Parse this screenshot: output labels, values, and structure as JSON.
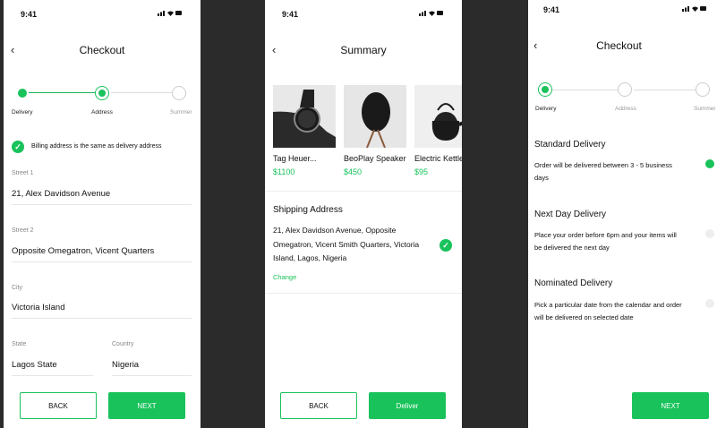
{
  "status": {
    "time": "9:41"
  },
  "screen1": {
    "title": "Checkout",
    "steps": [
      "Delivery",
      "Address",
      "Summer"
    ],
    "billing_same": "Billing address is the same as delivery address",
    "fields": {
      "street1": {
        "label": "Street 1",
        "value": "21, Alex Davidson Avenue"
      },
      "street2": {
        "label": "Street 2",
        "value": "Opposite Omegatron, Vicent Quarters"
      },
      "city": {
        "label": "City",
        "value": "Victoria Island"
      },
      "state": {
        "label": "State",
        "value": "Lagos State"
      },
      "country": {
        "label": "Country",
        "value": "Nigeria"
      }
    },
    "back_label": "BACK",
    "next_label": "NEXT"
  },
  "screen2": {
    "title": "Summary",
    "products": [
      {
        "name": "Tag Heuer...",
        "price": "$1100",
        "icon": "watch-image"
      },
      {
        "name": "BeoPlay Speaker",
        "price": "$450",
        "icon": "speaker-image"
      },
      {
        "name": "Electric Kettle",
        "price": "$95",
        "icon": "kettle-image"
      }
    ],
    "shipping_title": "Shipping Address",
    "shipping_lines": [
      "21, Alex Davidson Avenue, Opposite",
      "Omegatron, Vicent Smith Quarters, Victoria",
      "Island, Lagos, Nigeria"
    ],
    "change_label": "Change",
    "back_label": "BACK",
    "deliver_label": "Deliver"
  },
  "screen3": {
    "title": "Checkout",
    "steps": [
      "Delivery",
      "Address",
      "Summer"
    ],
    "options": [
      {
        "title": "Standard Delivery",
        "desc": [
          "Order will be delivered between 3 - 5 business",
          "days"
        ],
        "selected": true
      },
      {
        "title": "Next Day Delivery",
        "desc": [
          "Place your order before 6pm and your items will",
          "be delivered the next day"
        ],
        "selected": false
      },
      {
        "title": "Nominated Delivery",
        "desc": [
          "Pick a particular date from the calendar and order",
          "will be delivered on selected date"
        ],
        "selected": false
      }
    ],
    "next_label": "NEXT"
  },
  "colors": {
    "accent": "#19c25b",
    "background": "#2b2b2b"
  }
}
